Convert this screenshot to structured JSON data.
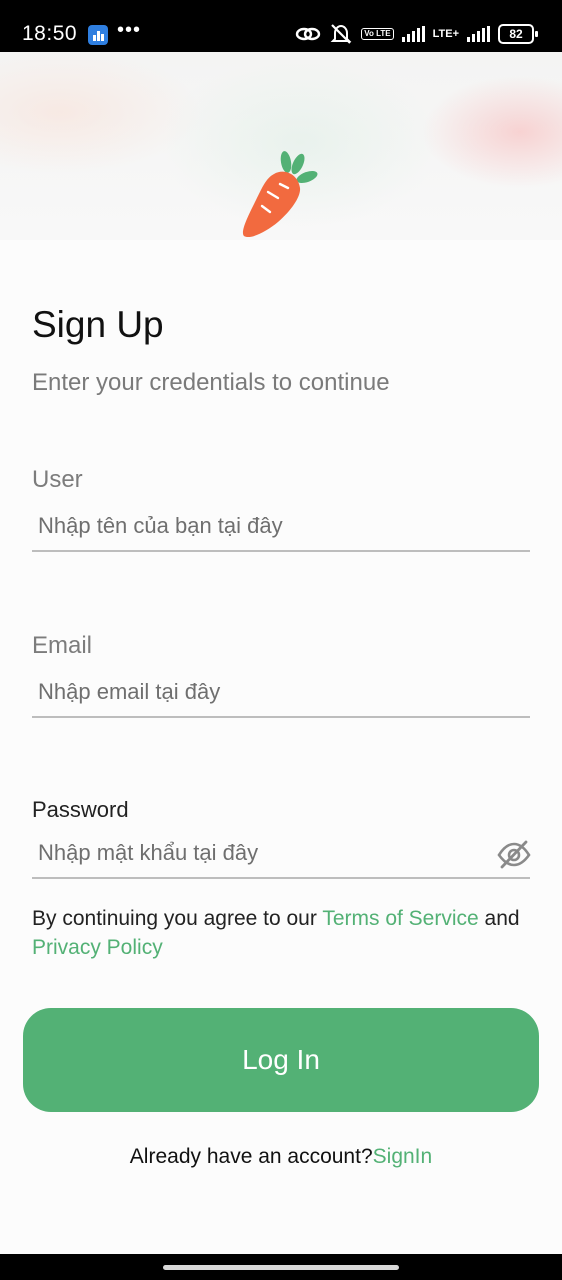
{
  "status_bar": {
    "time": "18:50",
    "dots": "•••",
    "volte": "Vo LTE",
    "lte": "LTE+",
    "battery": "82"
  },
  "header": {
    "logo_icon": "carrot-icon",
    "carrot_color": "#f26a3f",
    "leaf_color": "#53b175"
  },
  "form": {
    "title": "Sign Up",
    "subtitle": "Enter your credentials to continue",
    "user_label": "User",
    "user_placeholder": "Nhập tên của bạn tại đây",
    "email_label": "Email",
    "email_placeholder": "Nhập email tại đây",
    "password_label": "Password",
    "password_placeholder": "Nhập mật khẩu tại đây",
    "password_toggle_icon": "eye-off-icon"
  },
  "terms": {
    "prefix": "By continuing you agree to our ",
    "tos": "Terms of Service",
    "and": " and ",
    "privacy": "Privacy Policy"
  },
  "login_button": "Log In",
  "signin": {
    "prefix": "Already have an account?",
    "link": "SignIn"
  },
  "colors": {
    "accent": "#53b175"
  }
}
